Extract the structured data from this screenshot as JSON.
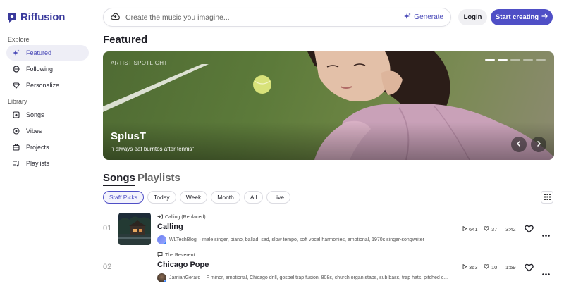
{
  "app": {
    "name": "Riffusion",
    "accent": "#4f4fc6"
  },
  "sidebar": {
    "explore_label": "Explore",
    "library_label": "Library",
    "explore_items": [
      {
        "label": "Featured",
        "icon": "sparkle-icon",
        "active": true
      },
      {
        "label": "Following",
        "icon": "following-icon"
      },
      {
        "label": "Personalize",
        "icon": "diamond-icon"
      }
    ],
    "library_items": [
      {
        "label": "Songs",
        "icon": "songs-icon"
      },
      {
        "label": "Vibes",
        "icon": "vibes-icon"
      },
      {
        "label": "Projects",
        "icon": "projects-icon"
      },
      {
        "label": "Playlists",
        "icon": "playlists-icon"
      }
    ]
  },
  "header": {
    "search_placeholder": "Create the music you imagine...",
    "generate_label": "Generate",
    "login_label": "Login",
    "start_label": "Start creating"
  },
  "featured": {
    "title": "Featured",
    "spotlight_label": "ARTIST SPOTLIGHT",
    "artist_name": "SplusT",
    "quote": "\"i always eat burritos after tennis\"",
    "slide_index": 2,
    "slide_count": 5
  },
  "tabs": {
    "songs": "Songs",
    "playlists": "Playlists"
  },
  "filters": [
    "Staff Picks",
    "Today",
    "Week",
    "Month",
    "All",
    "Live"
  ],
  "songs": [
    {
      "number": "01",
      "context": "Calling (Replaced)",
      "title": "Calling",
      "author": "WLTechBlog",
      "tags": "· male singer, piano, ballad, sad, slow tempo, soft vocal harmonies, emotional, 1970s singer-songwriter",
      "plays": "641",
      "likes": "37",
      "duration": "3:42"
    },
    {
      "number": "02",
      "context": "The Reverent",
      "title": "Chicago Pope",
      "author": "JamianGerard",
      "tags": "· F minor, emotional, Chicago drill, gospel trap fusion, 808s, church organ stabs, sub bass, trap hats, pitched c...",
      "plays": "363",
      "likes": "10",
      "duration": "1:59"
    }
  ]
}
